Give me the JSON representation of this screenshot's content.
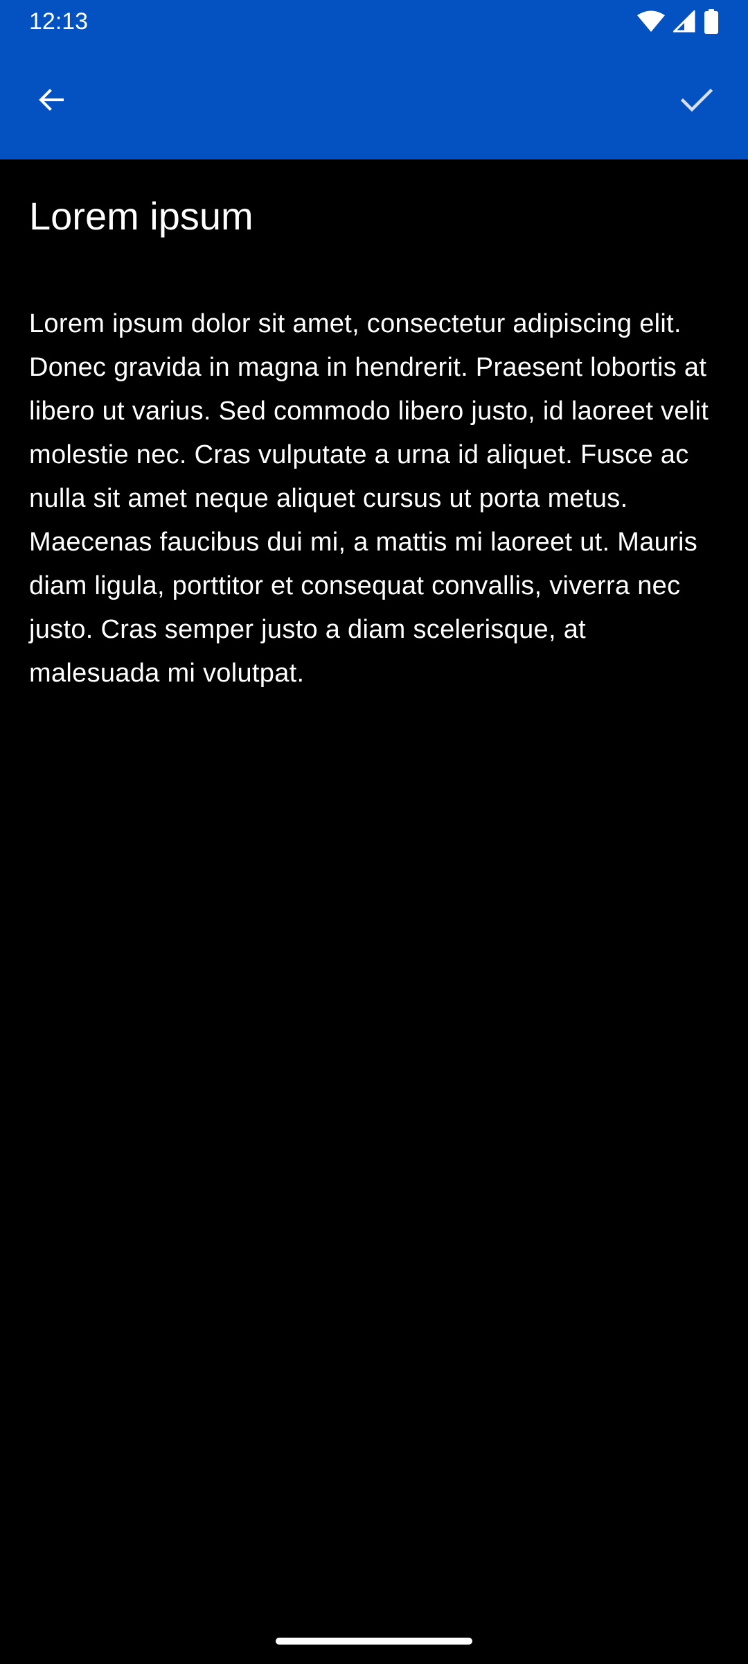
{
  "status_bar": {
    "time": "12:13",
    "icons": [
      "wifi-icon",
      "cell-signal-icon",
      "battery-icon"
    ]
  },
  "app_bar": {
    "back_icon": "arrow-left-icon",
    "confirm_icon": "checkmark-icon",
    "color": "#0451C1"
  },
  "content": {
    "title": "Lorem ipsum",
    "body": "Lorem ipsum dolor sit amet, consectetur adipiscing elit. Donec gravida in magna in hendrerit. Praesent lobortis at libero ut varius. Sed commodo libero justo, id laoreet velit molestie nec. Cras vulputate a urna id aliquet. Fusce ac nulla sit amet neque aliquet cursus ut porta metus. Maecenas faucibus dui mi, a mattis mi laoreet ut. Mauris diam ligula, porttitor et consequat convallis, viverra nec justo. Cras semper justo a diam scelerisque, at malesuada mi volutpat."
  },
  "colors": {
    "background": "#000000",
    "text": "#FFFFFF"
  }
}
